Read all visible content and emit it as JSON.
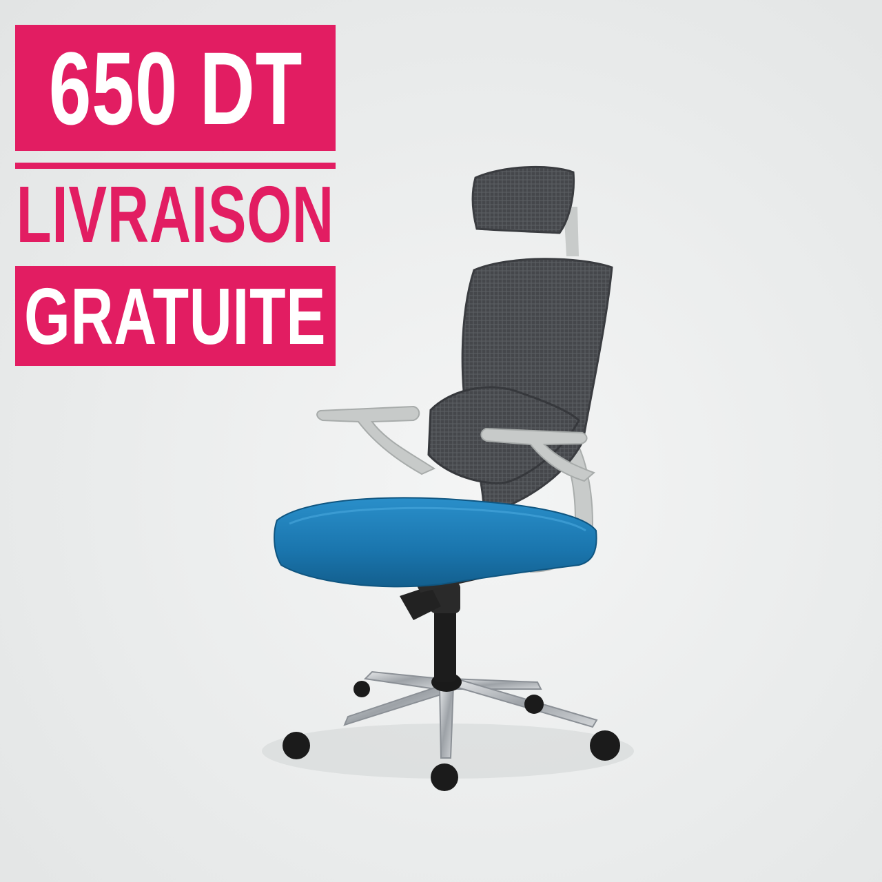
{
  "promo": {
    "price": "650 DT",
    "line1": "LIVRAISON",
    "line2": "GRATUITE"
  },
  "colors": {
    "accent": "#e21d62",
    "text_on_accent": "#ffffff",
    "background": "#eceeee",
    "seat": "#1f7fb8",
    "mesh": "#4a4c50",
    "frame": "#c9cccb",
    "chrome": "#b8bcc0"
  },
  "image": {
    "subject": "office-chair"
  }
}
